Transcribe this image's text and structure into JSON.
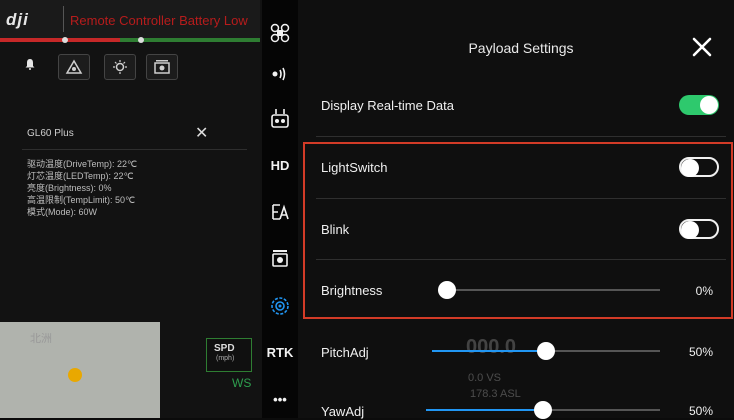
{
  "topbar": {
    "logo": "dji",
    "warning": "Remote Controller Battery Low"
  },
  "gl60": {
    "title": "GL60 Plus",
    "lines": [
      "驱动温度(DriveTemp): 22℃",
      "灯芯温度(LEDTemp): 22℃",
      "亮度(Brightness): 0%",
      "高温限制(TempLimit): 50℃",
      "模式(Mode): 60W"
    ]
  },
  "bg": {
    "spd": "SPD",
    "spd_unit": "(mph)",
    "ws": "WS",
    "map_label": "北洲",
    "ghost_num": "000.0",
    "ghost_vs": "0.0 VS",
    "ghost_asl": "178.3 ASL"
  },
  "rail": {
    "hd": "HD",
    "rtk": "RTK",
    "more": "•••"
  },
  "panel": {
    "title": "Payload Settings",
    "display_label": "Display Real-time Data",
    "display_on": true,
    "light_label": "LightSwitch",
    "light_on": false,
    "blink_label": "Blink",
    "blink_on": false,
    "brightness_label": "Brightness",
    "brightness_value": 0,
    "brightness_text": "0%",
    "pitch_label": "PitchAdj",
    "pitch_value": 50,
    "pitch_text": "50%",
    "yaw_label": "YawAdj",
    "yaw_value": 50,
    "yaw_text": "50%"
  },
  "colors": {
    "accent": "#2196f3",
    "toggle_on": "#2ec96d",
    "highlight": "#d33b27",
    "warning": "#b71c1c"
  }
}
